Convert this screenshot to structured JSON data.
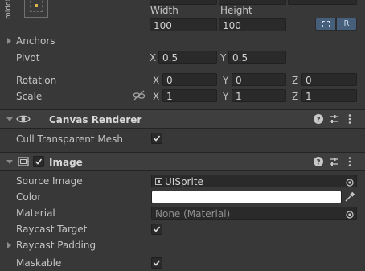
{
  "rect_transform": {
    "anchor_preset_side_label": "middle",
    "width_label": "Width",
    "height_label": "Height",
    "width_value": "100",
    "height_value": "100",
    "blueprint_mode_button": "⬚",
    "raw_edit_button": "R",
    "anchors_label": "Anchors",
    "pivot_label": "Pivot",
    "pivot_x_axis": "X",
    "pivot_x_value": "0.5",
    "pivot_y_axis": "Y",
    "pivot_y_value": "0.5",
    "rotation_label": "Rotation",
    "rotation_x_axis": "X",
    "rotation_x_value": "0",
    "rotation_y_axis": "Y",
    "rotation_y_value": "0",
    "rotation_z_axis": "Z",
    "rotation_z_value": "0",
    "scale_label": "Scale",
    "scale_x_axis": "X",
    "scale_x_value": "1",
    "scale_y_axis": "Y",
    "scale_y_value": "1",
    "scale_z_axis": "Z",
    "scale_z_value": "1"
  },
  "canvas_renderer": {
    "title": "Canvas Renderer",
    "cull_label": "Cull Transparent Mesh",
    "cull_checked": true
  },
  "image": {
    "title": "Image",
    "enabled": true,
    "source_image_label": "Source Image",
    "source_image_value": "UISprite",
    "color_label": "Color",
    "color_value": "#ffffff",
    "material_label": "Material",
    "material_value": "None (Material)",
    "raycast_target_label": "Raycast Target",
    "raycast_target_checked": true,
    "raycast_padding_label": "Raycast Padding",
    "maskable_label": "Maskable",
    "maskable_checked": true
  },
  "colors": {
    "background": "#383838",
    "header_background": "#3e3e3e",
    "field_background": "#2a2a2a",
    "active_button": "#46607c"
  }
}
